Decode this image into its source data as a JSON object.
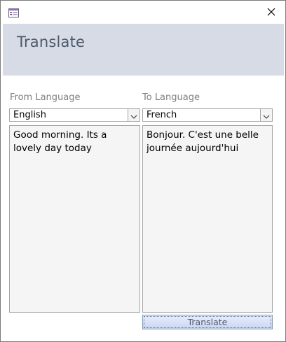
{
  "window": {
    "icon": "form-icon",
    "close_glyph": "✕"
  },
  "header": {
    "title": "Translate"
  },
  "from": {
    "label": "From Language",
    "selected": "English",
    "text": "Good morning. Its a lovely day today"
  },
  "to": {
    "label": "To Language",
    "selected": "French",
    "text": "Bonjour. C'est une belle journée aujourd'hui"
  },
  "actions": {
    "translate_label": "Translate"
  },
  "colors": {
    "header_band": "#d6dbe5",
    "label_text": "#7f7f7f",
    "textarea_bg": "#f5f5f5"
  }
}
